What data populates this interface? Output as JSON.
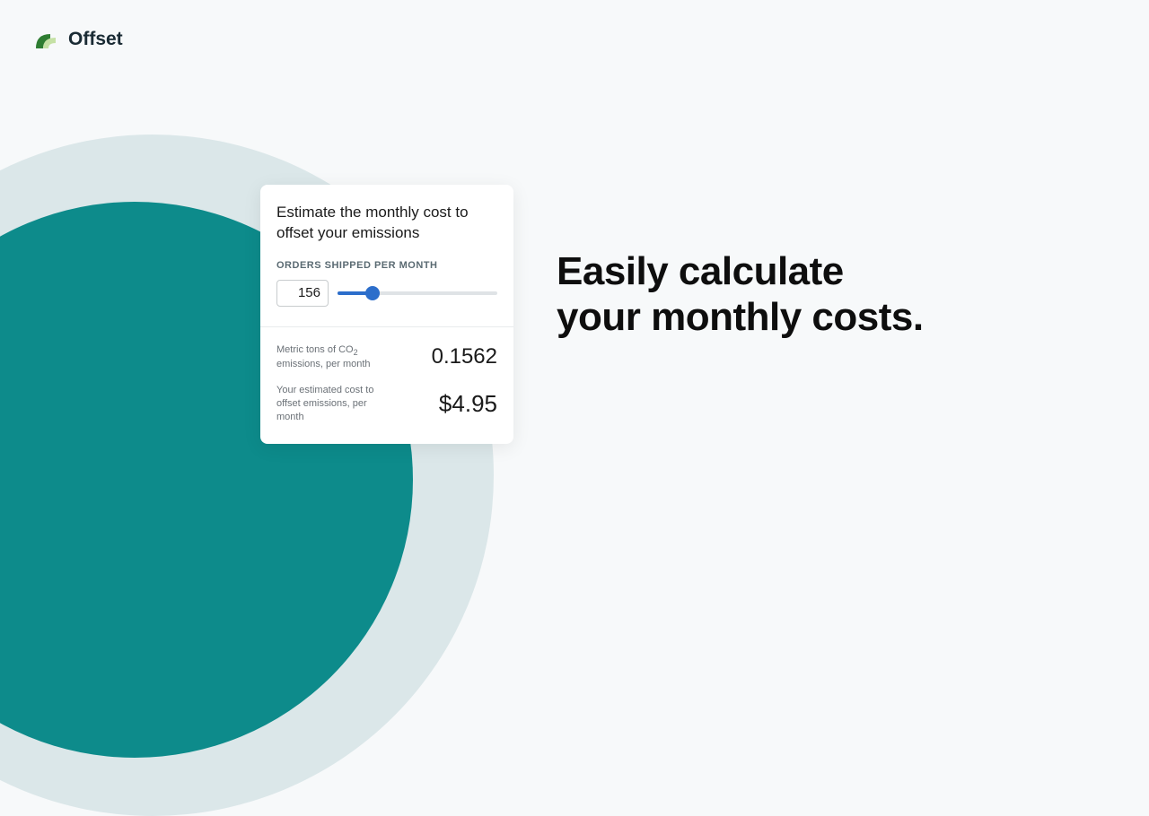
{
  "brand": {
    "name": "Offset"
  },
  "headline": {
    "line1": "Easily calculate",
    "line2": "your monthly costs."
  },
  "card": {
    "title": "Estimate the monthly cost to offset your emissions",
    "orders_label": "ORDERS SHIPPED PER MONTH",
    "orders_value": "156",
    "emissions_label_a": "Metric tons of CO",
    "emissions_label_b": "emissions, per month",
    "emissions_value": "0.1562",
    "cost_label_a": "Your estimated cost to",
    "cost_label_b": "offset emissions, per month",
    "cost_value": "$4.95"
  },
  "colors": {
    "accent": "#2c6ecb",
    "teal": "#0d8b8b",
    "teal_light": "#dbe7e9"
  }
}
